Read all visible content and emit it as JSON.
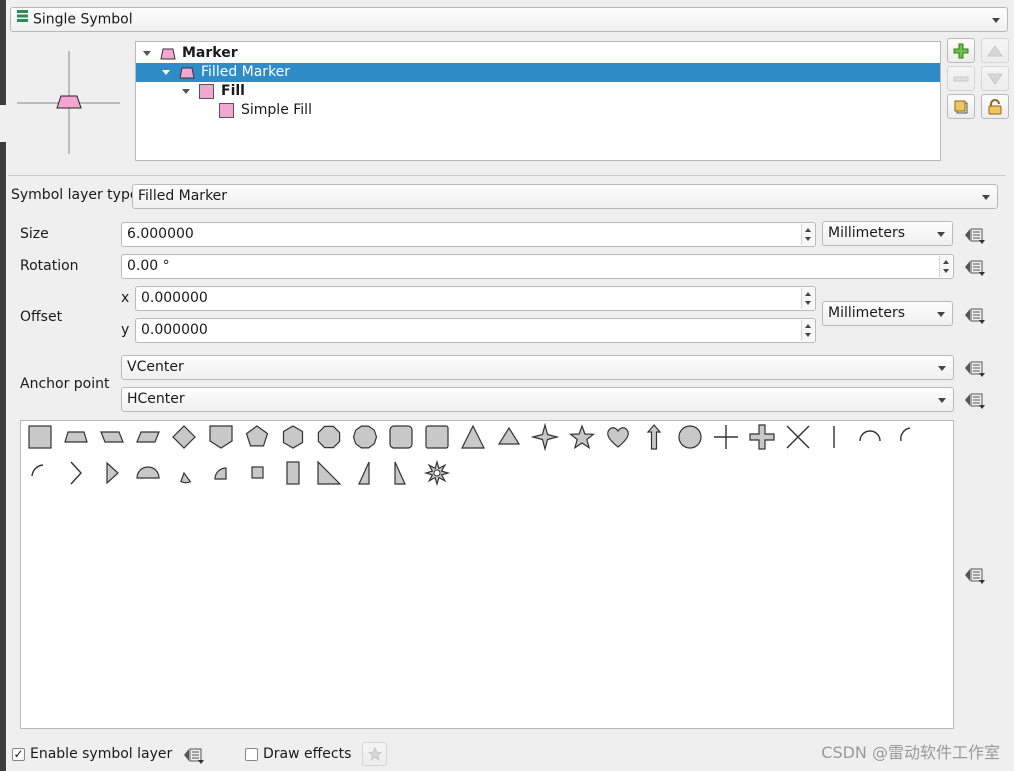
{
  "renderer": {
    "selected": "Single Symbol",
    "icon": "single-symbol-icon"
  },
  "tree": {
    "items": [
      {
        "label": "Marker",
        "bold": true,
        "expanded": true
      },
      {
        "label": "Filled Marker",
        "bold": false,
        "expanded": true,
        "selected": true
      },
      {
        "label": "Fill",
        "bold": true,
        "expanded": true
      },
      {
        "label": "Simple Fill",
        "bold": false
      }
    ],
    "swatch_color": "#f4a6d2"
  },
  "layer_buttons": [
    "add-layer-icon",
    "move-up-icon",
    "remove-layer-icon",
    "move-down-icon",
    "duplicate-layer-icon",
    "lock-layer-icon"
  ],
  "symbol_layer_type": {
    "label": "Symbol layer type",
    "value": "Filled Marker"
  },
  "size": {
    "label": "Size",
    "value": "6.000000",
    "unit": "Millimeters"
  },
  "rotation": {
    "label": "Rotation",
    "value": "0.00 °"
  },
  "offset": {
    "label": "Offset",
    "x_label": "x",
    "x_value": "0.000000",
    "y_label": "y",
    "y_value": "0.000000",
    "unit": "Millimeters"
  },
  "anchor": {
    "label": "Anchor point",
    "vertical": "VCenter",
    "horizontal": "HCenter"
  },
  "shapes": [
    "square",
    "trapezoid",
    "parallelogram-left",
    "parallelogram-right",
    "diamond",
    "shield",
    "pentagon",
    "hexagon",
    "octagon",
    "decagon",
    "rounded-square",
    "square-alt",
    "triangle",
    "equilateral-triangle",
    "star-4",
    "star-5",
    "heart",
    "arrow",
    "circle",
    "cross",
    "cross-fill",
    "cross-x",
    "line",
    "semi-arc",
    "third-arc",
    "quarter-arc",
    "arrowhead",
    "filled-arrowhead",
    "semicircle",
    "third-circle",
    "quarter-circle",
    "quarter-square",
    "half-square",
    "diagonal-half-square",
    "right-half-triangle",
    "left-half-triangle",
    "asterisk-fill"
  ],
  "footer": {
    "enable_label": "Enable symbol layer",
    "enable_checked": true,
    "effects_label": "Draw effects",
    "effects_checked": false
  },
  "watermark": "CSDN @雷动软件工作室",
  "colors": {
    "selection": "#308cc6",
    "shape_fill": "#c8c8c8",
    "shape_stroke": "#333333"
  }
}
